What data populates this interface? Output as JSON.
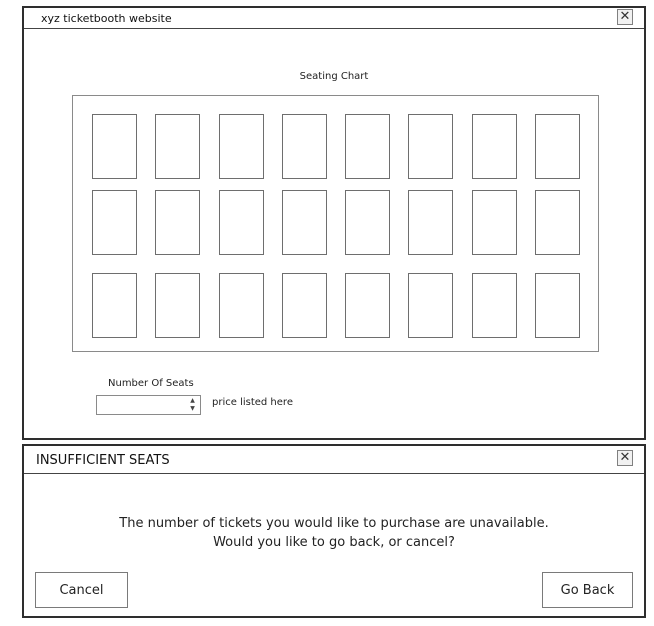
{
  "main_window": {
    "title": "xyz ticketbooth website",
    "close_glyph": "✕",
    "seating_chart": {
      "title": "Seating Chart",
      "rows": 3,
      "seats_per_row": 8
    },
    "seats_input": {
      "label": "Number Of Seats",
      "value": "",
      "spin_up_glyph": "▲",
      "spin_down_glyph": "▼"
    },
    "price_text": "price listed here"
  },
  "dialog": {
    "title": "INSUFFICIENT SEATS",
    "close_glyph": "✕",
    "message_line1": "The number of tickets you would like to purchase are unavailable.",
    "message_line2": "Would you like to go back, or cancel?",
    "cancel_label": "Cancel",
    "go_back_label": "Go Back"
  }
}
